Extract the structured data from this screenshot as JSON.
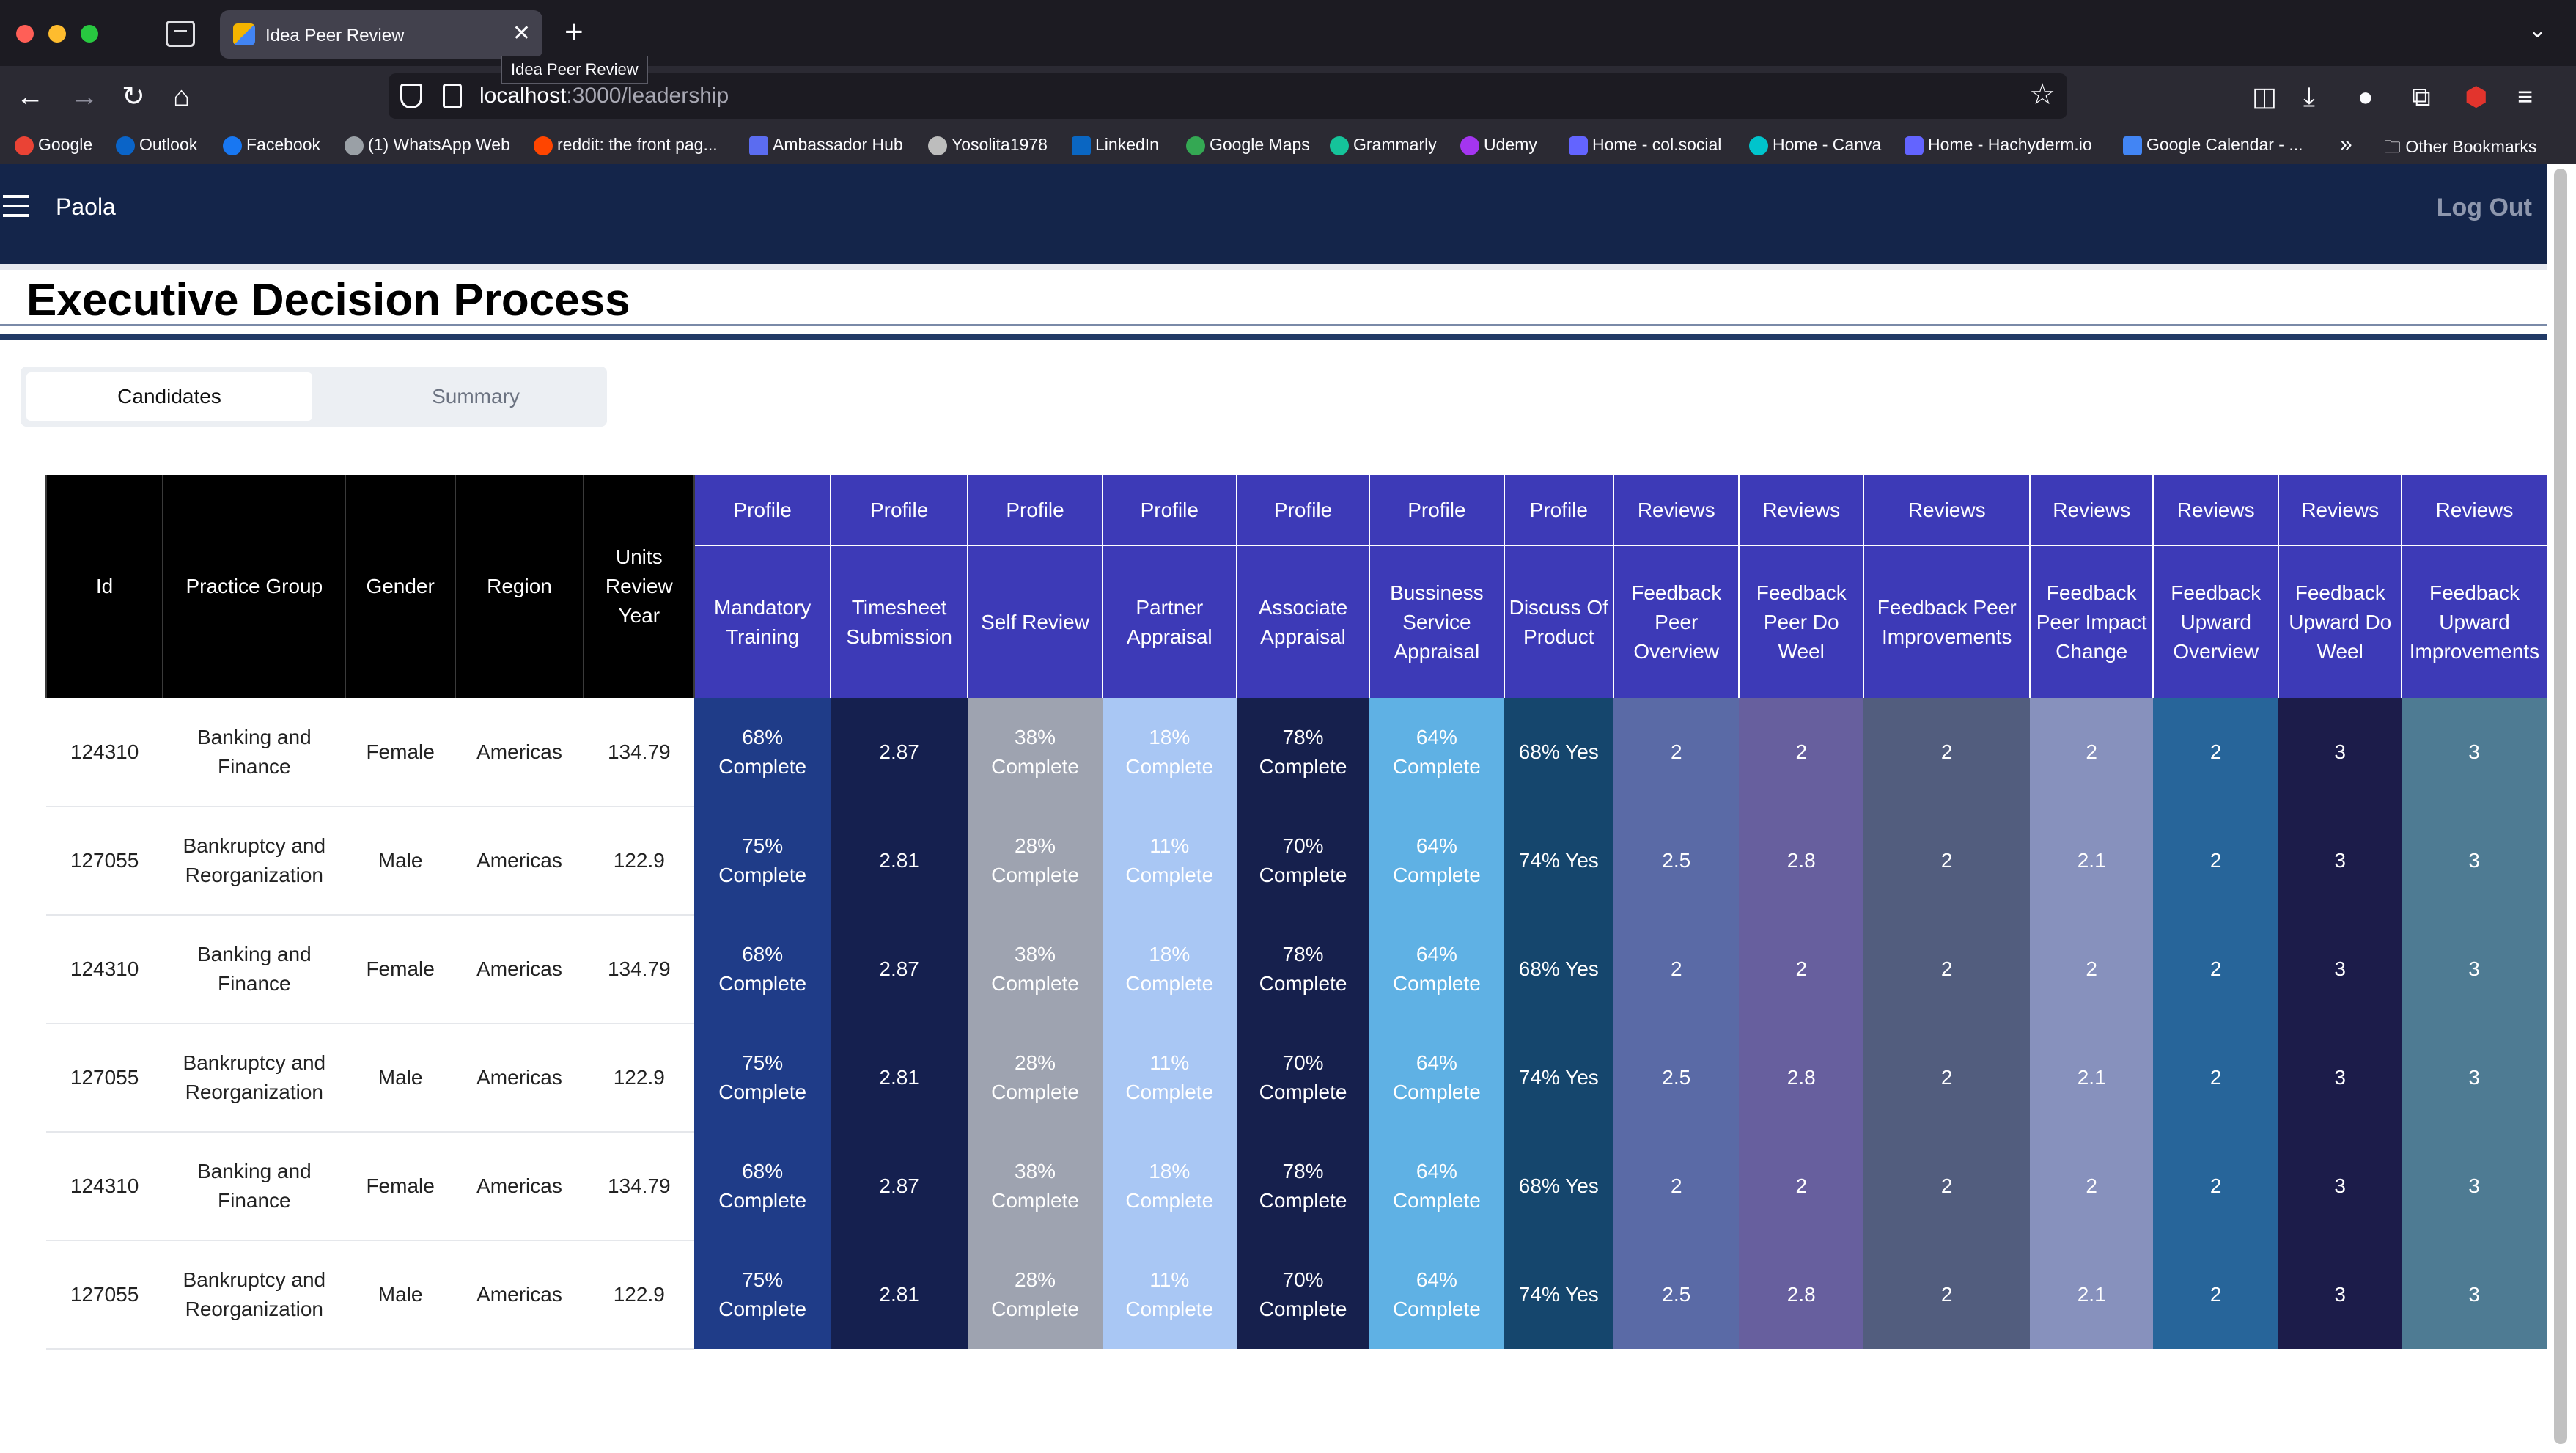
{
  "browser": {
    "tab_title": "Idea Peer Review",
    "tab_close": "✕",
    "new_tab": "+",
    "tabs_overflow": "⌄",
    "tooltip": "Idea Peer Review",
    "url_host": "localhost",
    "url_path": ":3000/leadership",
    "nav": {
      "back": "←",
      "forward": "→",
      "reload": "↻",
      "home": "⌂"
    },
    "star": "☆",
    "toolbar": [
      "pocket-icon",
      "download-icon",
      "profile-icon",
      "extensions-icon",
      "ublock-icon",
      "menu-icon"
    ],
    "bookmarks": [
      {
        "label": "Google",
        "color": "#ea4335"
      },
      {
        "label": "Outlook",
        "color": "#0a64c8"
      },
      {
        "label": "Facebook",
        "color": "#1877f2"
      },
      {
        "label": "(1) WhatsApp Web",
        "color": "#9aa0a6"
      },
      {
        "label": "reddit: the front pag...",
        "color": "#ff4500"
      },
      {
        "label": "Ambassador Hub",
        "color": "#5b6cf0"
      },
      {
        "label": "Yosolita1978",
        "color": "#bdbdbd"
      },
      {
        "label": "LinkedIn",
        "color": "#0a66c2"
      },
      {
        "label": "Google Maps",
        "color": "#34a853"
      },
      {
        "label": "Grammarly",
        "color": "#15c39a"
      },
      {
        "label": "Udemy",
        "color": "#a435f0"
      },
      {
        "label": "Home - col.social",
        "color": "#6364ff"
      },
      {
        "label": "Home - Canva",
        "color": "#00c4cc"
      },
      {
        "label": "Home - Hachyderm.io",
        "color": "#6364ff"
      },
      {
        "label": "Google Calendar - ...",
        "color": "#4285f4"
      }
    ],
    "bookmarks_overflow": "»",
    "other_bookmarks": "Other Bookmarks"
  },
  "app": {
    "user": "Paola",
    "logout": "Log Out",
    "page_title": "Executive Decision Process",
    "tabs": {
      "candidates": "Candidates",
      "summary": "Summary"
    }
  },
  "table": {
    "fixed_headers": [
      "Id",
      "Practice Group",
      "Gender",
      "Region",
      "Units Review Year"
    ],
    "group_headers": [
      "Profile",
      "Profile",
      "Profile",
      "Profile",
      "Profile",
      "Profile",
      "Profile",
      "Reviews",
      "Reviews",
      "Reviews",
      "Reviews",
      "Reviews",
      "Reviews",
      "Reviews"
    ],
    "sub_headers": [
      "Mandatory Training",
      "Timesheet Submission",
      "Self Review",
      "Partner Appraisal",
      "Associate Appraisal",
      "Bussiness Service Appraisal",
      "Discuss Of Product",
      "Feedback Peer Overview",
      "Feedback Peer Do Weel",
      "Feedback Peer Improvements",
      "Feedback Peer Impact Change",
      "Feedback Upward Overview",
      "Feedback Upward Do Weel",
      "Feedback Upward Improvements"
    ],
    "column_colors": [
      "#1f3c88",
      "#15204f",
      "#9ea3b0",
      "#a9c7f4",
      "#16204d",
      "#5fb1e4",
      "#15466d",
      "#5a6aa6",
      "#675f9e",
      "#525d7e",
      "#8791bd",
      "#27659a",
      "#1c1c4a",
      "#4e7b93"
    ],
    "rows": [
      {
        "id": "124310",
        "practice": "Banking and Finance",
        "gender": "Female",
        "region": "Americas",
        "units": "134.79",
        "cells": [
          "68% Complete",
          "2.87",
          "38% Complete",
          "18% Complete",
          "78% Complete",
          "64% Complete",
          "68% Yes",
          "2",
          "2",
          "2",
          "2",
          "2",
          "3",
          "3"
        ]
      },
      {
        "id": "127055",
        "practice": "Bankruptcy and Reorganization",
        "gender": "Male",
        "region": "Americas",
        "units": "122.9",
        "cells": [
          "75% Complete",
          "2.81",
          "28% Complete",
          "11% Complete",
          "70% Complete",
          "64% Complete",
          "74% Yes",
          "2.5",
          "2.8",
          "2",
          "2.1",
          "2",
          "3",
          "3"
        ]
      },
      {
        "id": "124310",
        "practice": "Banking and Finance",
        "gender": "Female",
        "region": "Americas",
        "units": "134.79",
        "cells": [
          "68% Complete",
          "2.87",
          "38% Complete",
          "18% Complete",
          "78% Complete",
          "64% Complete",
          "68% Yes",
          "2",
          "2",
          "2",
          "2",
          "2",
          "3",
          "3"
        ]
      },
      {
        "id": "127055",
        "practice": "Bankruptcy and Reorganization",
        "gender": "Male",
        "region": "Americas",
        "units": "122.9",
        "cells": [
          "75% Complete",
          "2.81",
          "28% Complete",
          "11% Complete",
          "70% Complete",
          "64% Complete",
          "74% Yes",
          "2.5",
          "2.8",
          "2",
          "2.1",
          "2",
          "3",
          "3"
        ]
      },
      {
        "id": "124310",
        "practice": "Banking and Finance",
        "gender": "Female",
        "region": "Americas",
        "units": "134.79",
        "cells": [
          "68% Complete",
          "2.87",
          "38% Complete",
          "18% Complete",
          "78% Complete",
          "64% Complete",
          "68% Yes",
          "2",
          "2",
          "2",
          "2",
          "2",
          "3",
          "3"
        ]
      },
      {
        "id": "127055",
        "practice": "Bankruptcy and Reorganization",
        "gender": "Male",
        "region": "Americas",
        "units": "122.9",
        "cells": [
          "75% Complete",
          "2.81",
          "28% Complete",
          "11% Complete",
          "70% Complete",
          "64% Complete",
          "74% Yes",
          "2.5",
          "2.8",
          "2",
          "2.1",
          "2",
          "3",
          "3"
        ]
      }
    ]
  }
}
